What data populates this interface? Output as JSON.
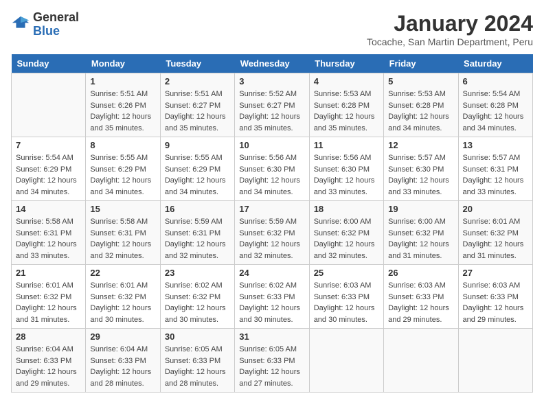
{
  "header": {
    "logo_general": "General",
    "logo_blue": "Blue",
    "title": "January 2024",
    "subtitle": "Tocache, San Martin Department, Peru"
  },
  "days_of_week": [
    "Sunday",
    "Monday",
    "Tuesday",
    "Wednesday",
    "Thursday",
    "Friday",
    "Saturday"
  ],
  "weeks": [
    [
      {
        "day": "",
        "info": ""
      },
      {
        "day": "1",
        "info": "Sunrise: 5:51 AM\nSunset: 6:26 PM\nDaylight: 12 hours\nand 35 minutes."
      },
      {
        "day": "2",
        "info": "Sunrise: 5:51 AM\nSunset: 6:27 PM\nDaylight: 12 hours\nand 35 minutes."
      },
      {
        "day": "3",
        "info": "Sunrise: 5:52 AM\nSunset: 6:27 PM\nDaylight: 12 hours\nand 35 minutes."
      },
      {
        "day": "4",
        "info": "Sunrise: 5:53 AM\nSunset: 6:28 PM\nDaylight: 12 hours\nand 35 minutes."
      },
      {
        "day": "5",
        "info": "Sunrise: 5:53 AM\nSunset: 6:28 PM\nDaylight: 12 hours\nand 34 minutes."
      },
      {
        "day": "6",
        "info": "Sunrise: 5:54 AM\nSunset: 6:28 PM\nDaylight: 12 hours\nand 34 minutes."
      }
    ],
    [
      {
        "day": "7",
        "info": "Sunrise: 5:54 AM\nSunset: 6:29 PM\nDaylight: 12 hours\nand 34 minutes."
      },
      {
        "day": "8",
        "info": "Sunrise: 5:55 AM\nSunset: 6:29 PM\nDaylight: 12 hours\nand 34 minutes."
      },
      {
        "day": "9",
        "info": "Sunrise: 5:55 AM\nSunset: 6:29 PM\nDaylight: 12 hours\nand 34 minutes."
      },
      {
        "day": "10",
        "info": "Sunrise: 5:56 AM\nSunset: 6:30 PM\nDaylight: 12 hours\nand 34 minutes."
      },
      {
        "day": "11",
        "info": "Sunrise: 5:56 AM\nSunset: 6:30 PM\nDaylight: 12 hours\nand 33 minutes."
      },
      {
        "day": "12",
        "info": "Sunrise: 5:57 AM\nSunset: 6:30 PM\nDaylight: 12 hours\nand 33 minutes."
      },
      {
        "day": "13",
        "info": "Sunrise: 5:57 AM\nSunset: 6:31 PM\nDaylight: 12 hours\nand 33 minutes."
      }
    ],
    [
      {
        "day": "14",
        "info": "Sunrise: 5:58 AM\nSunset: 6:31 PM\nDaylight: 12 hours\nand 33 minutes."
      },
      {
        "day": "15",
        "info": "Sunrise: 5:58 AM\nSunset: 6:31 PM\nDaylight: 12 hours\nand 32 minutes."
      },
      {
        "day": "16",
        "info": "Sunrise: 5:59 AM\nSunset: 6:31 PM\nDaylight: 12 hours\nand 32 minutes."
      },
      {
        "day": "17",
        "info": "Sunrise: 5:59 AM\nSunset: 6:32 PM\nDaylight: 12 hours\nand 32 minutes."
      },
      {
        "day": "18",
        "info": "Sunrise: 6:00 AM\nSunset: 6:32 PM\nDaylight: 12 hours\nand 32 minutes."
      },
      {
        "day": "19",
        "info": "Sunrise: 6:00 AM\nSunset: 6:32 PM\nDaylight: 12 hours\nand 31 minutes."
      },
      {
        "day": "20",
        "info": "Sunrise: 6:01 AM\nSunset: 6:32 PM\nDaylight: 12 hours\nand 31 minutes."
      }
    ],
    [
      {
        "day": "21",
        "info": "Sunrise: 6:01 AM\nSunset: 6:32 PM\nDaylight: 12 hours\nand 31 minutes."
      },
      {
        "day": "22",
        "info": "Sunrise: 6:01 AM\nSunset: 6:32 PM\nDaylight: 12 hours\nand 30 minutes."
      },
      {
        "day": "23",
        "info": "Sunrise: 6:02 AM\nSunset: 6:32 PM\nDaylight: 12 hours\nand 30 minutes."
      },
      {
        "day": "24",
        "info": "Sunrise: 6:02 AM\nSunset: 6:33 PM\nDaylight: 12 hours\nand 30 minutes."
      },
      {
        "day": "25",
        "info": "Sunrise: 6:03 AM\nSunset: 6:33 PM\nDaylight: 12 hours\nand 30 minutes."
      },
      {
        "day": "26",
        "info": "Sunrise: 6:03 AM\nSunset: 6:33 PM\nDaylight: 12 hours\nand 29 minutes."
      },
      {
        "day": "27",
        "info": "Sunrise: 6:03 AM\nSunset: 6:33 PM\nDaylight: 12 hours\nand 29 minutes."
      }
    ],
    [
      {
        "day": "28",
        "info": "Sunrise: 6:04 AM\nSunset: 6:33 PM\nDaylight: 12 hours\nand 29 minutes."
      },
      {
        "day": "29",
        "info": "Sunrise: 6:04 AM\nSunset: 6:33 PM\nDaylight: 12 hours\nand 28 minutes."
      },
      {
        "day": "30",
        "info": "Sunrise: 6:05 AM\nSunset: 6:33 PM\nDaylight: 12 hours\nand 28 minutes."
      },
      {
        "day": "31",
        "info": "Sunrise: 6:05 AM\nSunset: 6:33 PM\nDaylight: 12 hours\nand 27 minutes."
      },
      {
        "day": "",
        "info": ""
      },
      {
        "day": "",
        "info": ""
      },
      {
        "day": "",
        "info": ""
      }
    ]
  ]
}
